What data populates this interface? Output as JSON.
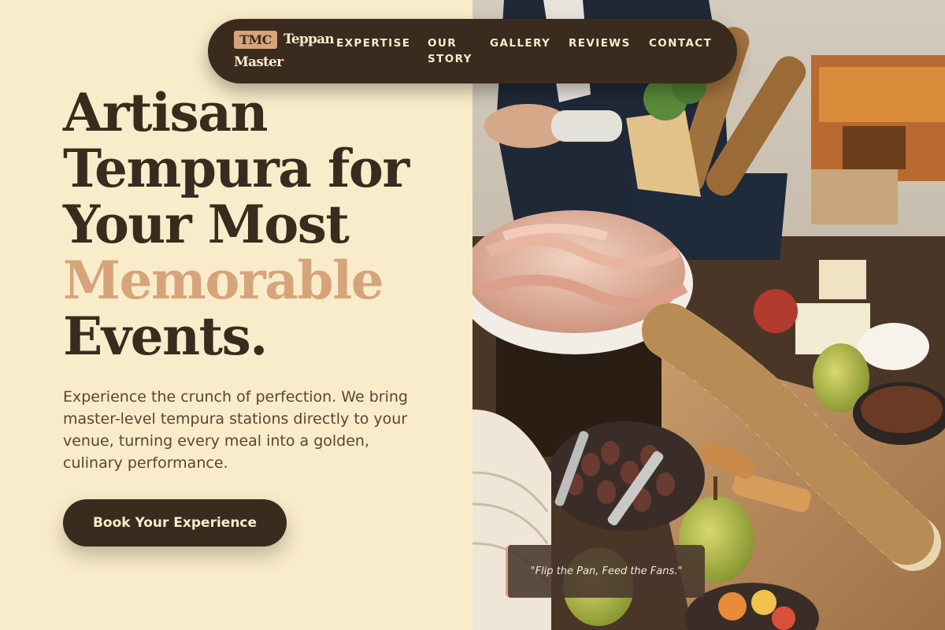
{
  "brand": {
    "badge": "TMC",
    "word1": "Teppan",
    "word2": "Master"
  },
  "nav": {
    "items": [
      {
        "line1": "EXPERTISE",
        "line2": ""
      },
      {
        "line1": "OUR",
        "line2": "STORY"
      },
      {
        "line1": "GALLERY",
        "line2": ""
      },
      {
        "line1": "REVIEWS",
        "line2": ""
      },
      {
        "line1": "CONTACT",
        "line2": ""
      }
    ]
  },
  "hero": {
    "headline": {
      "line1": "Artisan",
      "line2": "Tempura for",
      "line3": "Your Most",
      "accent": "Memorable",
      "line5": "Events."
    },
    "description": "Experience the crunch of perfection. We bring master-level tempura stations directly to your venue, turning every meal into a golden, culinary performance.",
    "cta_label": "Book Your Experience"
  },
  "gallery": {
    "quote": "\"Flip the Pan, Feed the Fans.\""
  },
  "colors": {
    "background": "#f9ecca",
    "dark": "#3b2a1e",
    "accent": "#d6a47b"
  }
}
